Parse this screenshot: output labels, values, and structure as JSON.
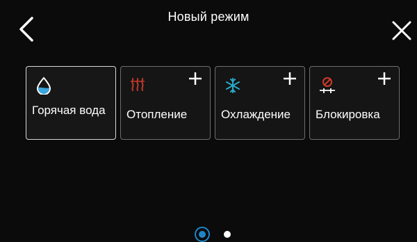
{
  "header": {
    "title": "Новый режим",
    "back_icon": "chevron-left-icon",
    "close_icon": "close-icon"
  },
  "modes": [
    {
      "label": "Горячая вода",
      "icon": "water-drop-icon",
      "selected": true,
      "has_plus": false
    },
    {
      "label": "Отопление",
      "icon": "heating-icon",
      "selected": false,
      "has_plus": true
    },
    {
      "label": "Охлаждение",
      "icon": "snowflake-icon",
      "selected": false,
      "has_plus": true
    },
    {
      "label": "Блокировка",
      "icon": "blocking-icon",
      "selected": false,
      "has_plus": true
    }
  ],
  "pager": {
    "page": 1,
    "pages": 2
  },
  "colors": {
    "background": "#0b0b0b",
    "accent": "#1e86c8",
    "heating": "#c0392b",
    "cooling": "#2aa9c9",
    "blocking": "#d23a2a",
    "water": "#3aa6dc"
  }
}
